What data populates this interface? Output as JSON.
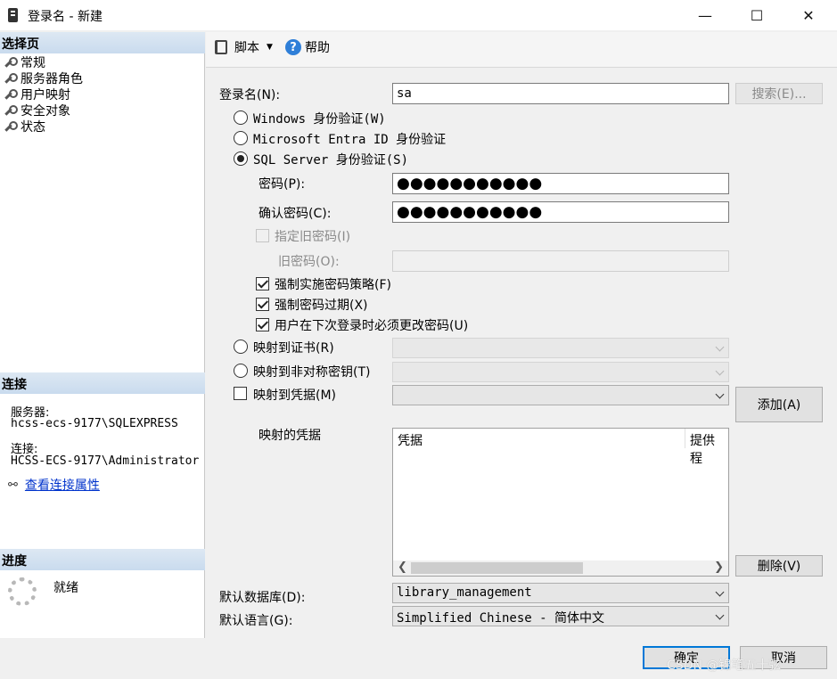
{
  "window": {
    "title": "登录名 - 新建",
    "minimize_glyph": "—",
    "maximize_glyph": "☐",
    "close_glyph": "✕"
  },
  "left": {
    "select_page_header": "选择页",
    "pages": [
      "常规",
      "服务器角色",
      "用户映射",
      "安全对象",
      "状态"
    ],
    "connection_header": "连接",
    "server_label": "服务器:",
    "server_value": "hcss-ecs-9177\\SQLEXPRESS",
    "connection_label": "连接:",
    "connection_value": "HCSS-ECS-9177\\Administrator",
    "view_props_link": "查看连接属性",
    "progress_header": "进度",
    "progress_status": "就绪"
  },
  "toolbar": {
    "script_label": "脚本",
    "help_label": "帮助"
  },
  "form": {
    "login_name_label": "登录名(N):",
    "login_name_value": "sa",
    "search_button": "搜索(E)...",
    "auth_windows": "Windows 身份验证(W)",
    "auth_entra": "Microsoft Entra ID 身份验证",
    "auth_sql": "SQL Server 身份验证(S)",
    "password_label": "密码(P):",
    "password_value": "●●●●●●●●●●●",
    "confirm_label": "确认密码(C):",
    "confirm_value": "●●●●●●●●●●●",
    "specify_old_label": "指定旧密码(I)",
    "old_password_label": "旧密码(O):",
    "enforce_policy_label": "强制实施密码策略(F)",
    "enforce_expiration_label": "强制密码过期(X)",
    "must_change_label": "用户在下次登录时必须更改密码(U)",
    "map_cert_label": "映射到证书(R)",
    "map_asym_label": "映射到非对称密钥(T)",
    "map_cred_label": "映射到凭据(M)",
    "add_button": "添加(A)",
    "mapped_cred_label": "映射的凭据",
    "grid_col_cred": "凭据",
    "grid_col_provider": "提供程",
    "remove_button": "删除(V)",
    "default_db_label": "默认数据库(D):",
    "default_db_value": "library_management",
    "default_lang_label": "默认语言(G):",
    "default_lang_value": "Simplified Chinese - 简体中文",
    "ok_button": "确定",
    "cancel_button": "取消"
  },
  "watermark": "CSDN @锦笔五十弦"
}
